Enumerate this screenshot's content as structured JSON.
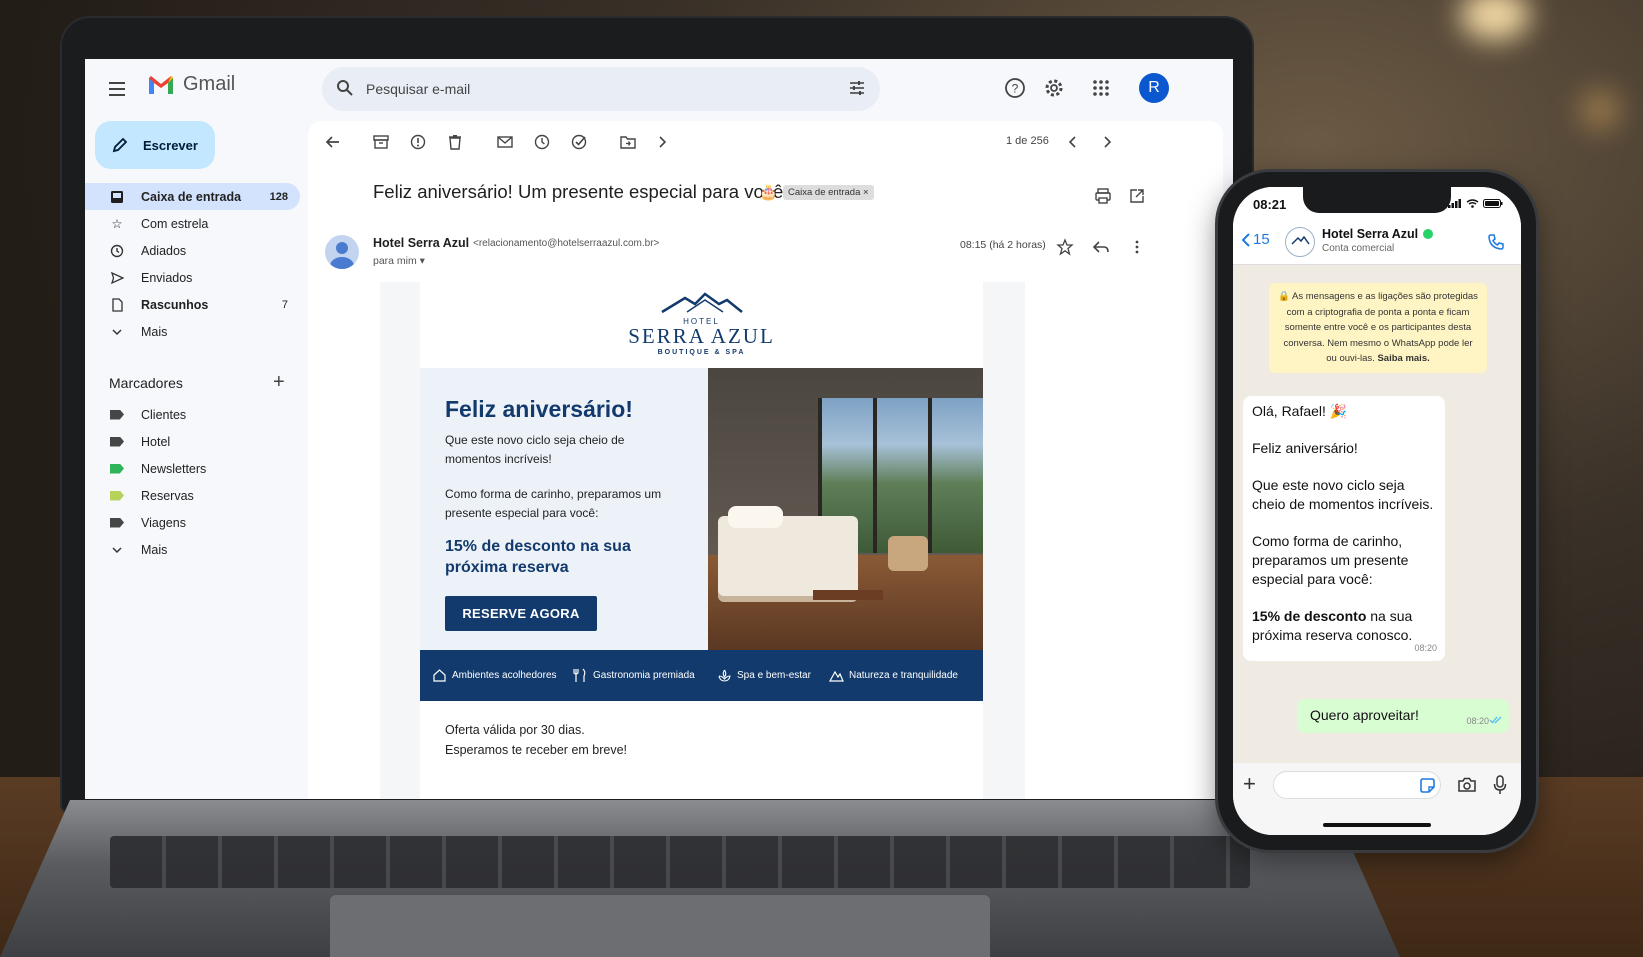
{
  "gmail": {
    "app_name": "Gmail",
    "search_placeholder": "Pesquisar e-mail",
    "avatar_initial": "R",
    "compose_label": "Escrever",
    "nav": [
      {
        "label": "Caixa de entrada",
        "count": "128",
        "icon": "inbox-icon"
      },
      {
        "label": "Com estrela",
        "count": "",
        "icon": "star-icon"
      },
      {
        "label": "Adiados",
        "count": "",
        "icon": "clock-icon"
      },
      {
        "label": "Enviados",
        "count": "",
        "icon": "send-icon"
      },
      {
        "label": "Rascunhos",
        "count": "7",
        "icon": "draft-icon"
      },
      {
        "label": "Mais",
        "count": "",
        "icon": "chevron-down-icon"
      }
    ],
    "labels_title": "Marcadores",
    "labels": [
      {
        "label": "Clientes",
        "color": "#444746"
      },
      {
        "label": "Hotel",
        "color": "#444746"
      },
      {
        "label": "Newsletters",
        "color": "#2fb45a"
      },
      {
        "label": "Reservas",
        "color": "#b5d35b"
      },
      {
        "label": "Viagens",
        "color": "#444746"
      },
      {
        "label": "Mais",
        "color": ""
      }
    ],
    "pager": "1 de 256",
    "subject": "Feliz aniversário! Um presente especial para você",
    "subject_emoji": "🎂",
    "subject_chip": "Caixa de entrada ×",
    "sender_name": "Hotel Serra Azul",
    "sender_email": "<relacionamento@hotelserraazul.com.br>",
    "to": "para mim ▾",
    "time": "08:15 (há 2 horas)"
  },
  "email": {
    "logo_hotel": "HOTEL",
    "logo_name": "SERRA AZUL",
    "logo_sub": "BOUTIQUE & SPA",
    "title": "Feliz aniversário!",
    "p1": "Que este novo ciclo seja cheio de momentos incríveis!",
    "p2": "Como forma de carinho, preparamos um presente especial para você:",
    "offer": "15% de desconto na sua próxima reserva",
    "cta": "RESERVE AGORA",
    "amenities": [
      "Ambientes acolhedores",
      "Gastronomia premiada",
      "Spa e bem-estar",
      "Natureza e tranquilidade"
    ],
    "footer1": "Oferta válida por 30 dias.",
    "footer2": "Esperamos te receber em breve!",
    "brand_color": "#123a6d"
  },
  "whatsapp": {
    "time": "08:21",
    "back_count": "15",
    "contact_name": "Hotel Serra Azul",
    "contact_sub": "Conta comercial",
    "encryption_notice": "🔒 As mensagens e as ligações são protegidas com a criptografia de ponta a ponta e ficam somente entre você e os participantes desta conversa. Nem mesmo o WhatsApp pode ler ou ouvi-las.",
    "encryption_link": "Saiba mais.",
    "msg_in": {
      "line1": "Olá, Rafael! 🎉",
      "line2": "Feliz aniversário!",
      "line3": "Que este novo ciclo seja cheio de momentos incríveis.",
      "line4": "Como forma de carinho, preparamos um presente especial para você:",
      "line5_bold": "15% de desconto",
      "line5_rest": " na sua próxima reserva conosco.",
      "time": "08:20"
    },
    "msg_out": {
      "text": "Quero aproveitar!",
      "time": "08:20"
    },
    "accent": "#25d366"
  }
}
